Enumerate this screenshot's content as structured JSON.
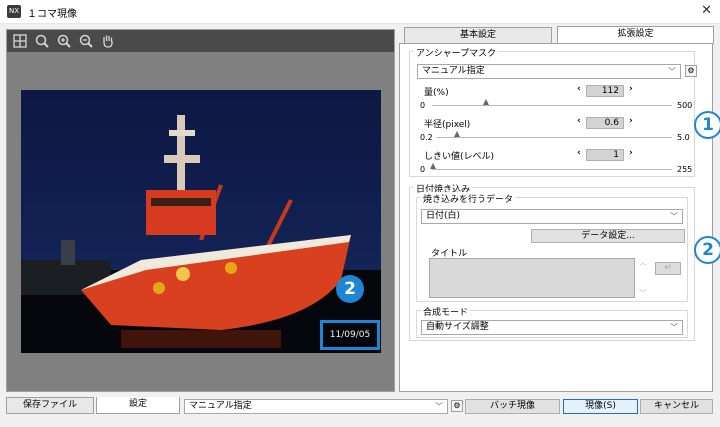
{
  "window": {
    "title": "１コマ現像",
    "close_symbol": "✕",
    "icon_text": "NX"
  },
  "preview": {
    "toolbar_icons": [
      "grid-icon",
      "zoom-fit-icon",
      "zoom-in-icon",
      "zoom-out-icon",
      "hand-icon"
    ],
    "date_stamp": "11/09/05",
    "callout": "2"
  },
  "tabs": {
    "basic": "基本設定",
    "extended": "拡張設定"
  },
  "unsharp": {
    "heading": "アンシャープマスク",
    "mode": "マニュアル指定",
    "amount": {
      "label": "量(%)",
      "value": "112",
      "min": "0",
      "max": "500",
      "fraction": 0.224
    },
    "radius": {
      "label": "半径(pixel)",
      "value": "0.6",
      "min": "0.2",
      "max": "5.0",
      "fraction": 0.083
    },
    "threshold": {
      "label": "しきい値(レベル)",
      "value": "1",
      "min": "0",
      "max": "255",
      "fraction": 0.004
    }
  },
  "imprint": {
    "heading": "日付焼き込み",
    "data_heading": "焼き込みを行うデータ",
    "data_value": "日付(白)",
    "data_settings_button": "データ設定...",
    "title_label": "タイトル",
    "mode_heading": "合成モード",
    "mode_value": "自動サイズ調整"
  },
  "callouts": {
    "one": "1",
    "two": "2"
  },
  "bottom": {
    "save_tab": "保存ファイル",
    "settings_tab": "設定",
    "preset": "マニュアル指定",
    "batch_button": "バッチ現像",
    "develop_button": "現像(S)",
    "cancel_button": "キャンセル"
  },
  "colors": {
    "accent": "#1f86d6",
    "toolbar": "#4a4a4a",
    "preview_bg": "#808080"
  }
}
